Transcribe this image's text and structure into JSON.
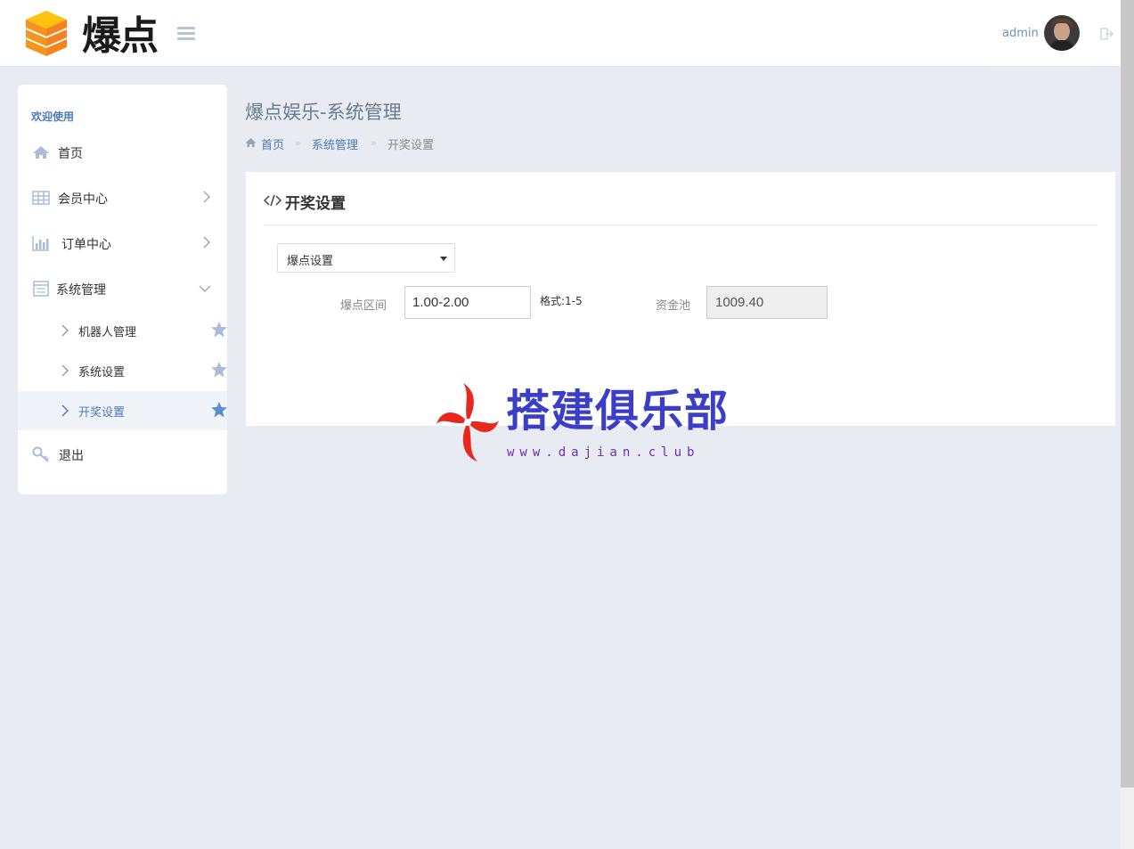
{
  "brand": {
    "logo_text": "爆点"
  },
  "header": {
    "user_name": "admin"
  },
  "sidebar": {
    "welcome": "欢迎使用",
    "items": [
      {
        "label": "首页",
        "icon": "home-icon"
      },
      {
        "label": "会员中心",
        "icon": "table-icon"
      },
      {
        "label": "订单中心",
        "icon": "bar-chart-icon"
      },
      {
        "label": "系统管理",
        "icon": "list-alt-icon"
      }
    ],
    "subitems": [
      {
        "label": "机器人管理"
      },
      {
        "label": "系统设置"
      },
      {
        "label": "开奖设置"
      }
    ],
    "logout": "退出"
  },
  "page": {
    "title": "爆点娱乐-系统管理",
    "breadcrumb": [
      "首页",
      "系统管理",
      "开奖设置"
    ],
    "breadcrumb_sep": "»"
  },
  "panel": {
    "title": "开奖设置",
    "select_value": "爆点设置",
    "range_label": "爆点区间",
    "range_value": "1.00-2.00",
    "format_hint": "格式:1-5",
    "pool_label": "资金池",
    "pool_value": "1009.40"
  },
  "watermark": {
    "text": "搭建俱乐部",
    "url": "www.dajian.club"
  },
  "colors": {
    "accent": "#4a7ab8",
    "background": "#e8ebf2",
    "star_inactive": "#a9bdd6",
    "star_active": "#5b8fd0"
  }
}
